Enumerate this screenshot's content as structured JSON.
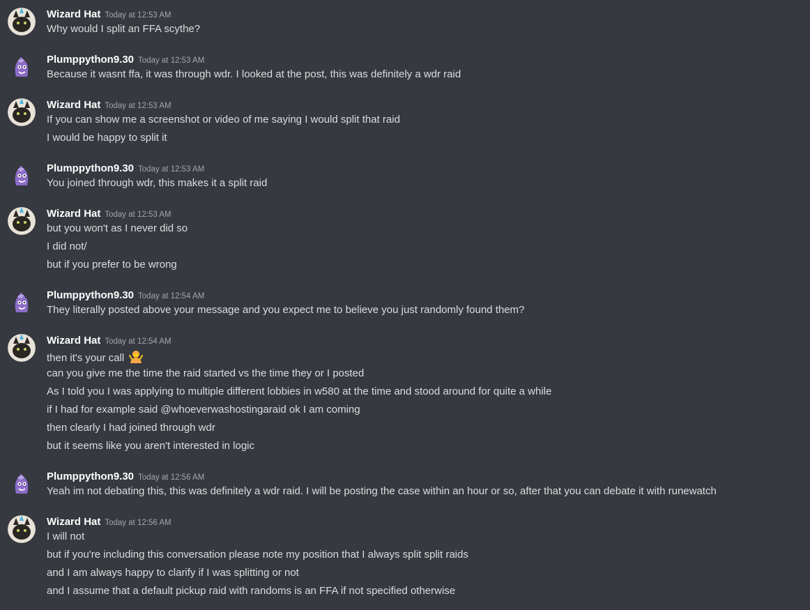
{
  "messages": [
    {
      "author": "Wizard Hat",
      "avatar": "cat-avatar-icon",
      "timestamp": "Today at 12:53 AM",
      "lines": [
        "Why would I split an FFA scythe?"
      ]
    },
    {
      "author": "Plumppython9.30",
      "avatar": "purple-creature-avatar-icon",
      "timestamp": "Today at 12:53 AM",
      "lines": [
        "Because it wasnt ffa, it was through wdr. I looked at the post, this was definitely a wdr raid"
      ]
    },
    {
      "author": "Wizard Hat",
      "avatar": "cat-avatar-icon",
      "timestamp": "Today at 12:53 AM",
      "lines": [
        "If you can show me a screenshot or video of me saying I would split that raid",
        "I would be happy to split it"
      ]
    },
    {
      "author": "Plumppython9.30",
      "avatar": "purple-creature-avatar-icon",
      "timestamp": "Today at 12:53 AM",
      "lines": [
        "You joined through wdr, this makes it a split raid"
      ]
    },
    {
      "author": "Wizard Hat",
      "avatar": "cat-avatar-icon",
      "timestamp": "Today at 12:53 AM",
      "lines": [
        "but you won't as I never did so",
        "I did not/",
        "but if you prefer to be wrong"
      ]
    },
    {
      "author": "Plumppython9.30",
      "avatar": "purple-creature-avatar-icon",
      "timestamp": "Today at 12:54 AM",
      "lines": [
        "They literally posted above your message and you expect me to believe you just randomly found them?"
      ]
    },
    {
      "author": "Wizard Hat",
      "avatar": "cat-avatar-icon",
      "timestamp": "Today at 12:54 AM",
      "lines": [
        "then it's your call",
        "can you give me the time the raid started vs the time they or I posted",
        "As I told you I was applying to multiple different lobbies in w580 at the time and stood around for quite a while",
        "if I had for example said @whoeverwashostingaraid ok I am coming",
        "then clearly I had joined through wdr",
        "but it seems like you aren't interested in logic"
      ],
      "emoji": "person-shrugging-emoji"
    },
    {
      "author": "Plumppython9.30",
      "avatar": "purple-creature-avatar-icon",
      "timestamp": "Today at 12:56 AM",
      "lines": [
        "Yeah im not debating this, this was definitely a wdr raid. I will be posting the case within an hour or so, after that you can debate it with runewatch"
      ]
    },
    {
      "author": "Wizard Hat",
      "avatar": "cat-avatar-icon",
      "timestamp": "Today at 12:56 AM",
      "lines": [
        "I will not",
        "but if you're including this conversation please note my position that I always split split raids",
        "and I am always happy to clarify if I was splitting or not",
        "and I assume that a default pickup raid with randoms is an FFA if not specified otherwise"
      ]
    }
  ],
  "colors": {
    "background": "#36393f",
    "username": "#ffffff",
    "timestamp": "#a3a6aa",
    "text": "#dcddde"
  }
}
